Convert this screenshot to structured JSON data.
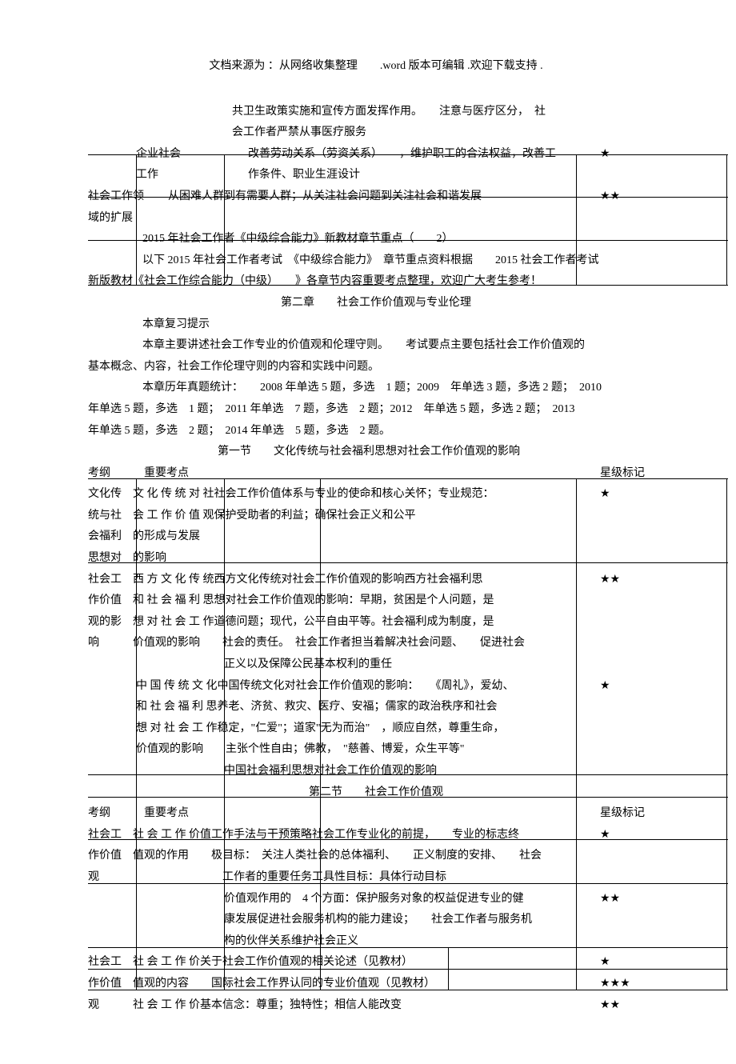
{
  "header": "文档来源为 ：从网络收集整理　　.word 版本可编辑 .欢迎下载支持 .",
  "p1": "共卫生政策实施和宣传方面发挥作用。　　注意与医疗区分，　社",
  "p2": "会工作者严禁从事医疗服务",
  "row_enterprise_l": "企业社会",
  "row_enterprise_m": "改善劳动关系（劳资关系）　　，维护职工的合法权益，改善工",
  "row_enterprise_star": "★",
  "row_work_l": "工作",
  "row_work_m": "作条件、职业生涯设计",
  "row_field_l": "社会工作领",
  "row_field_m": "从困难人群到有需要人群；从关注社会问题到关注社会和谐发展",
  "row_field_star": "★★",
  "row_field2_l": "域的扩展",
  "title2015": "2015 年社会工作者《中级综合能力》新教材章节重点（　　2）",
  "p_intro1": "以下 2015 年社会工作者考试　《中级综合能力》　章节重点资料根据　　2015 社会工作者考试",
  "p_intro2": "新版教材《社会工作综合能力（中级）　　》各章节内容重要考点整理，欢迎广大考生参考！",
  "ch2_title": "第二章　　社会工作价值观与专业伦理",
  "p_review_t": "本章复习提示",
  "p_review1": "本章主要讲述社会工作专业的价值观和伦理守则。　　考试要点主要包括社会工作价值观的",
  "p_review2": "基本概念、内容，社会工作伦理守则的内容和实践中问题。",
  "p_hist1": "本章历年真题统计：　　2008 年单选 5 题，多选　1 题；2009　年单选 3 题，多选 2 题；　2010",
  "p_hist2": "年单选 5 题，多选　1 题；　2011 年单选　7 题，多选　2 题；2012　年单选 5 题，多选 2 题；　2013",
  "p_hist3": "年单选 5 题，多选　2 题；　2014 年单选　5 题，多选　2 题。",
  "sec1_title": "第一节　　文化传统与社会福利思想对社会工作价值观的影响",
  "thead_l": "考纲",
  "thead_m": "重要考点",
  "thead_r": "星级标记",
  "r1a": "文化传　文 化 传 统 对 社社会工作价值体系与专业的使命和核心关怀；专业规范：",
  "r1a_star": "★",
  "r1b": "统与社　会 工 作 价 值 观保护受助者的利益；确保社会正义和公平",
  "r1c": "会福利　的形成与发展",
  "r1d": "思想对　的影响",
  "r2a": "社会工　西 方 文 化 传 统西方文化传统对社会工作价值观的影响西方社会福利思",
  "r2a_star": "★★",
  "r2b": "作价值　和 社 会 福 利 思想对社会工作价值观的影响：早期，贫困是个人问题，是",
  "r2c": "观的影　想 对 社 会 工 作道德问题；现代，公平自由平等。社会福利成为制度，是",
  "r2d": "响　　　价值观的影响　　社会的责任。　社会工作者担当着解决社会问题、　　促进社会",
  "r2e": "正义以及保障公民基本权利的重任",
  "r3a": "中 国 传 统 文 化中国传统文化对社会工作价值观的影响：　　《周礼》，爱幼、",
  "r3a_star": "★",
  "r3b": "和 社 会 福 利 思养老、济贫、救灾、医疗、安福；儒家的政治秩序和社会",
  "r3c": "想 对 社 会 工 作稳定，\"仁爱\"；道家\"无为而治\"　，顺应自然，尊重生命，",
  "r3d": "价值观的影响　　主张个性自由；佛教，　\"慈善、博爱，众生平等\"",
  "r3e": "中国社会福利思想对社会工作价值观的影响",
  "sec2_title": "第二节　　社会工作价值观",
  "s2r1a": "社会工　社 会 工 作 价值工作手法与干预策略社会工作专业化的前提，　　专业的标志终",
  "s2r1a_star": "★",
  "s2r1b": "作价值　值观的作用　　极目标：　关注人类社会的总体福利、　　正义制度的安排、　　社会",
  "s2r1c": "观　　　　　　　　　　　工作者的重要任务工具性目标：具体行动目标",
  "s2r2a": "价值观作用的　4 个方面：保护服务对象的权益促进专业的健",
  "s2r2a_star": "★★",
  "s2r2b": "康发展促进社会服务机构的能力建设；　　社会工作者与服务机",
  "s2r2c": "构的伙伴关系维护社会正义",
  "s2r3a": "社会工　社 会 工 作 价关于社会工作价值观的相关论述（见教材）",
  "s2r3a_star": "★",
  "s2r3b": "作价值　值观的内容　　国际社会工作界认同的专业价值观（见教材）",
  "s2r3b_star": "★★★",
  "s2r3c": "观　　　社 会 工 作 价基本信念：尊重；独特性；相信人能改变",
  "s2r3c_star": "★★"
}
